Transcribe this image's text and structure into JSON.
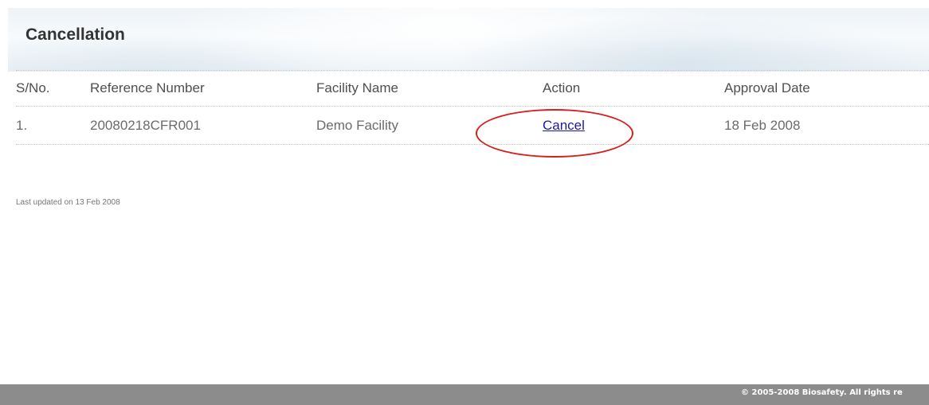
{
  "page": {
    "title": "Cancellation"
  },
  "table": {
    "headers": {
      "sno": "S/No.",
      "reference": "Reference Number",
      "facility": "Facility Name",
      "action": "Action",
      "approval_date": "Approval Date"
    },
    "rows": [
      {
        "sno": "1.",
        "reference": "20080218CFR001",
        "facility": "Demo Facility",
        "action": "Cancel",
        "approval_date": "18 Feb 2008"
      }
    ]
  },
  "last_updated": "Last updated on 13 Feb 2008",
  "footer": {
    "copyright": "© 2005-2008 Biosafety. All rights re"
  },
  "colors": {
    "link": "#1a1aa6",
    "highlight_circle": "#d61f1f",
    "footer_bg": "#8c8c8c"
  }
}
